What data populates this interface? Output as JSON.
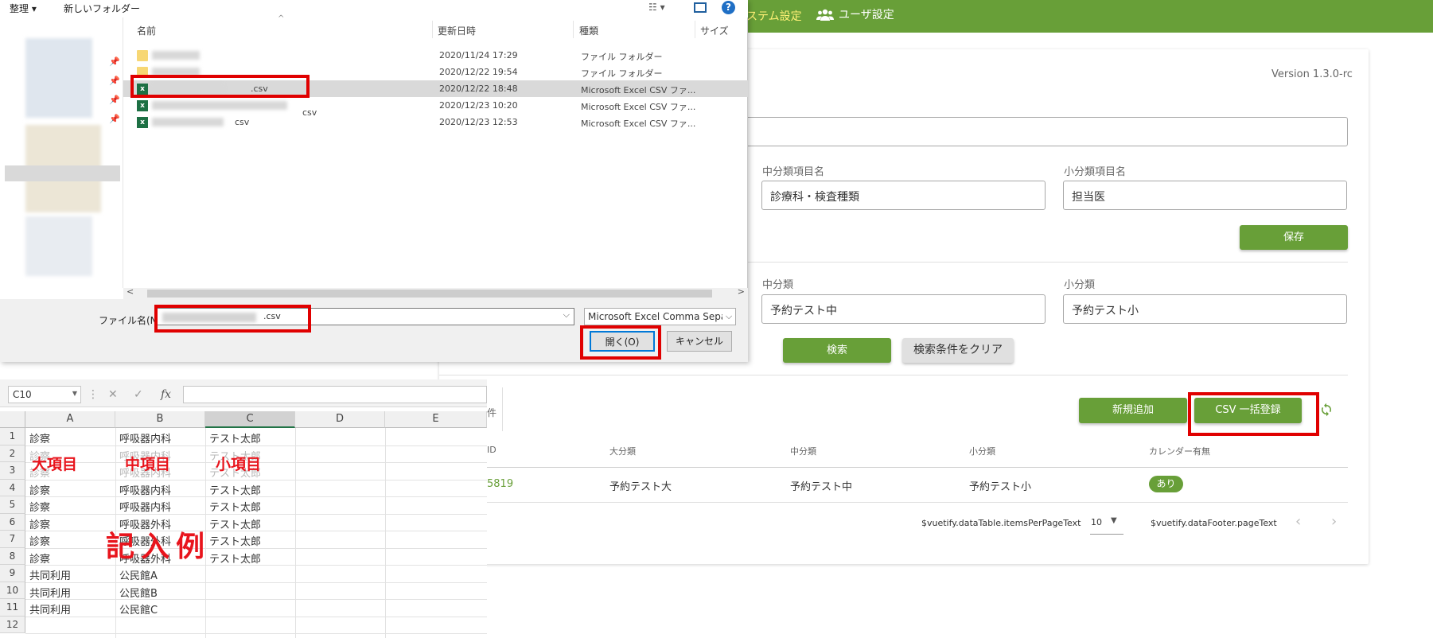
{
  "webapp": {
    "nav_system": "ステム設定",
    "nav_users": "ユーザ設定",
    "version": "Version 1.3.0-rc",
    "form": {
      "mid_label": "中分類項目名",
      "mid_value": "診療科・検査種類",
      "small_label": "小分類項目名",
      "small_value": "担当医",
      "save_button": "保存"
    },
    "search": {
      "mid_label": "中分類",
      "mid_value": "予約テスト中",
      "small_label": "小分類",
      "small_value": "予約テスト小",
      "search_button": "検索",
      "clear_button": "検索条件をクリア"
    },
    "list": {
      "count_suffix": "件",
      "new_button": "新規追加",
      "csv_button": "CSV 一括登録",
      "headers": [
        "ID",
        "大分類",
        "中分類",
        "小分類",
        "カレンダー有無"
      ],
      "row": {
        "id": "5819",
        "large": "予約テスト大",
        "mid": "予約テスト中",
        "small": "予約テスト小",
        "calendar": "あり"
      },
      "items_per_page_text": "$vuetify.dataTable.itemsPerPageText",
      "items_per_page_value": "10",
      "page_text": "$vuetify.dataFooter.pageText"
    }
  },
  "dialog": {
    "toolbar": {
      "organize": "整理 ▾",
      "new_folder": "新しいフォルダー"
    },
    "columns": [
      "名前",
      "更新日時",
      "種類",
      "サイズ"
    ],
    "files": [
      {
        "name": "",
        "date": "2020/11/24 17:29",
        "type": "ファイル フォルダー",
        "icon": "folder-icon"
      },
      {
        "name": "",
        "date": "2020/12/22 19:54",
        "type": "ファイル フォルダー",
        "icon": "folder-icon"
      },
      {
        "name": ".csv",
        "date": "2020/12/22 18:48",
        "type": "Microsoft Excel CSV ファ...",
        "icon": "excel-icon"
      },
      {
        "name": "csv",
        "date": "2020/12/23 10:20",
        "type": "Microsoft Excel CSV ファ...",
        "icon": "excel-icon"
      },
      {
        "name": "csv",
        "date": "2020/12/23 12:53",
        "type": "Microsoft Excel CSV ファ...",
        "icon": "excel-icon"
      }
    ],
    "filename_label": "ファイル名(N):",
    "filename_value": ".csv",
    "filetype": "Microsoft Excel Comma Separated",
    "open_button": "開く(O)",
    "cancel_button": "キャンセル"
  },
  "excel": {
    "namebox": "C10",
    "columns": [
      "A",
      "B",
      "C",
      "D",
      "E"
    ],
    "rows": [
      [
        "1",
        "診察",
        "呼吸器内科",
        "テスト太郎"
      ],
      [
        "2",
        "診察",
        "呼吸器内科",
        "テスト太郎"
      ],
      [
        "3",
        "診察",
        "呼吸器内科",
        "テスト太郎"
      ],
      [
        "4",
        "診察",
        "呼吸器内科",
        "テスト太郎"
      ],
      [
        "5",
        "診察",
        "呼吸器内科",
        "テスト太郎"
      ],
      [
        "6",
        "診察",
        "呼吸器外科",
        "テスト太郎"
      ],
      [
        "7",
        "診察",
        "呼吸器外科",
        "テスト太郎"
      ],
      [
        "8",
        "診察",
        "呼吸器外科",
        "テスト太郎"
      ],
      [
        "9",
        "共同利用",
        "公民館A",
        ""
      ],
      [
        "10",
        "共同利用",
        "公民館B",
        ""
      ],
      [
        "11",
        "共同利用",
        "公民館C",
        ""
      ],
      [
        "12",
        "",
        "",
        ""
      ]
    ],
    "annotations": {
      "large": "大項目",
      "mid": "中項目",
      "small": "小項目",
      "example": "記入例"
    }
  },
  "colors": {
    "brand_green": "#689f38",
    "highlight_red": "#e00000",
    "annotation_red": "#e8141c"
  }
}
